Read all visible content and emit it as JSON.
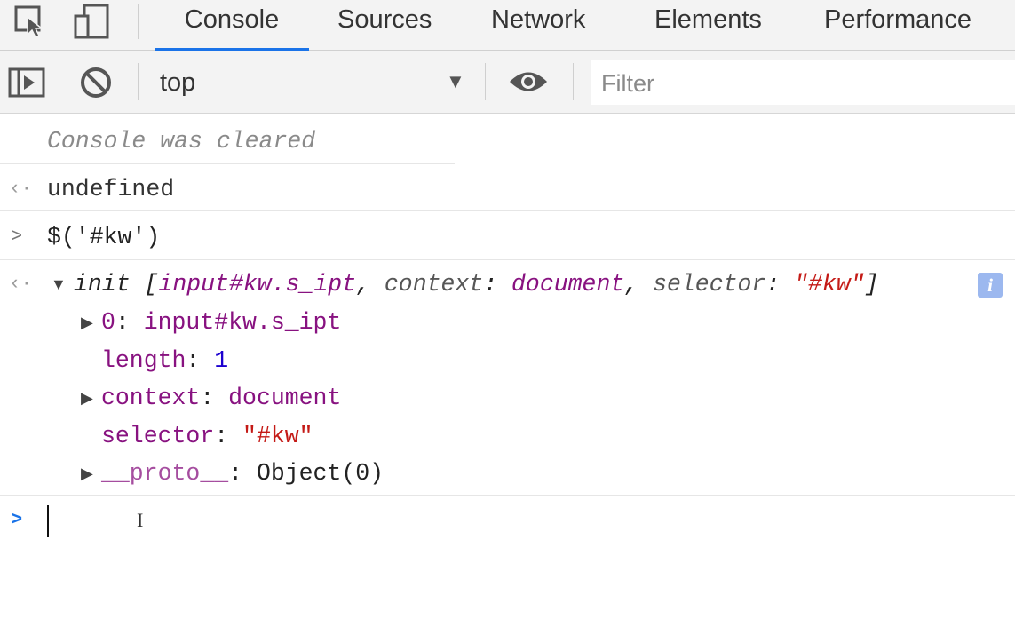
{
  "tabs": [
    {
      "label": "Console",
      "active": true
    },
    {
      "label": "Sources"
    },
    {
      "label": "Network"
    },
    {
      "label": "Elements"
    },
    {
      "label": "Performance"
    }
  ],
  "toolbar": {
    "context": "top",
    "filter_placeholder": "Filter"
  },
  "console": {
    "cleared_msg": "Console was cleared",
    "result1": "undefined",
    "input1": "$('#kw')",
    "obj": {
      "head_init": "init",
      "head_open": " [",
      "head_el": "input#kw.s_ipt",
      "head_sep1": ", ",
      "head_ctx_key": "context",
      "head_colon1": ": ",
      "head_ctx_val": "document",
      "head_sep2": ", ",
      "head_sel_key": "selector",
      "head_colon2": ": ",
      "head_sel_val": "\"#kw\"",
      "head_close": "]",
      "p0_key": "0",
      "p0_val": "input#kw.s_ipt",
      "len_key": "length",
      "len_val": "1",
      "ctx_key": "context",
      "ctx_val": "document",
      "sel_key": "selector",
      "sel_val": "\"#kw\"",
      "proto_key": "__proto__",
      "proto_val": "Object(0)",
      "colon": ": "
    },
    "info_badge": "i"
  },
  "colors": {
    "accent": "#1a73e8",
    "prop_key": "#881280",
    "string": "#c41a16",
    "number": "#1c00cf",
    "prompt": "#1a73e8"
  }
}
